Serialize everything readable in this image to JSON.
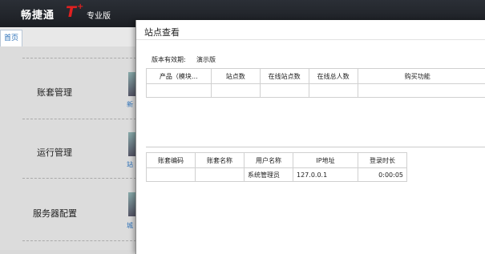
{
  "app": {
    "brand": "畅捷通",
    "brand_t": "T",
    "brand_plus": "+",
    "edition": "专业版"
  },
  "tabs": {
    "home": "首页"
  },
  "nav": [
    {
      "label": "账套管理",
      "icon_label": "新"
    },
    {
      "label": "运行管理",
      "icon_label": "站"
    },
    {
      "label": "服务器配置",
      "icon_label": "城"
    }
  ],
  "dialog": {
    "title": "站点查看",
    "version_label": "版本有效期:",
    "version_value": "演示版",
    "product_table": {
      "headers": [
        "产品（模块…",
        "站点数",
        "在线站点数",
        "在线总人数",
        "购买功能"
      ]
    },
    "session_table": {
      "headers": [
        "账套编码",
        "账套名称",
        "用户名称",
        "IP地址",
        "登录时长"
      ],
      "rows": [
        {
          "code": "",
          "name": "",
          "user": "系统管理员",
          "ip": "127.0.0.1",
          "duration": "0:00:05"
        }
      ]
    }
  }
}
